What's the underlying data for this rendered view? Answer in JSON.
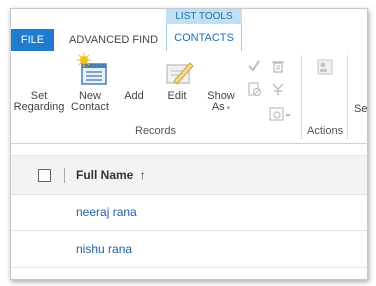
{
  "tabs": {
    "file": "FILE",
    "advanced_find": "ADVANCED FIND",
    "context_group": "LIST TOOLS",
    "contacts": "CONTACTS"
  },
  "ribbon": {
    "set_regarding": [
      "Set",
      "Regarding"
    ],
    "new_contact": [
      "New",
      "Contact"
    ],
    "add": "Add",
    "edit": "Edit",
    "show_as": [
      "Show",
      "As"
    ],
    "records_group": "Records",
    "actions_group": "Actions",
    "partial_label": "Se"
  },
  "grid": {
    "column_full_name": "Full Name",
    "sort_indicator": "↑",
    "rows": [
      "neeraj rana",
      "nishu rana"
    ]
  },
  "colors": {
    "file_tab": "#1e7bd0",
    "context_header": "#bfe1f3",
    "link": "#1f5fa8"
  }
}
